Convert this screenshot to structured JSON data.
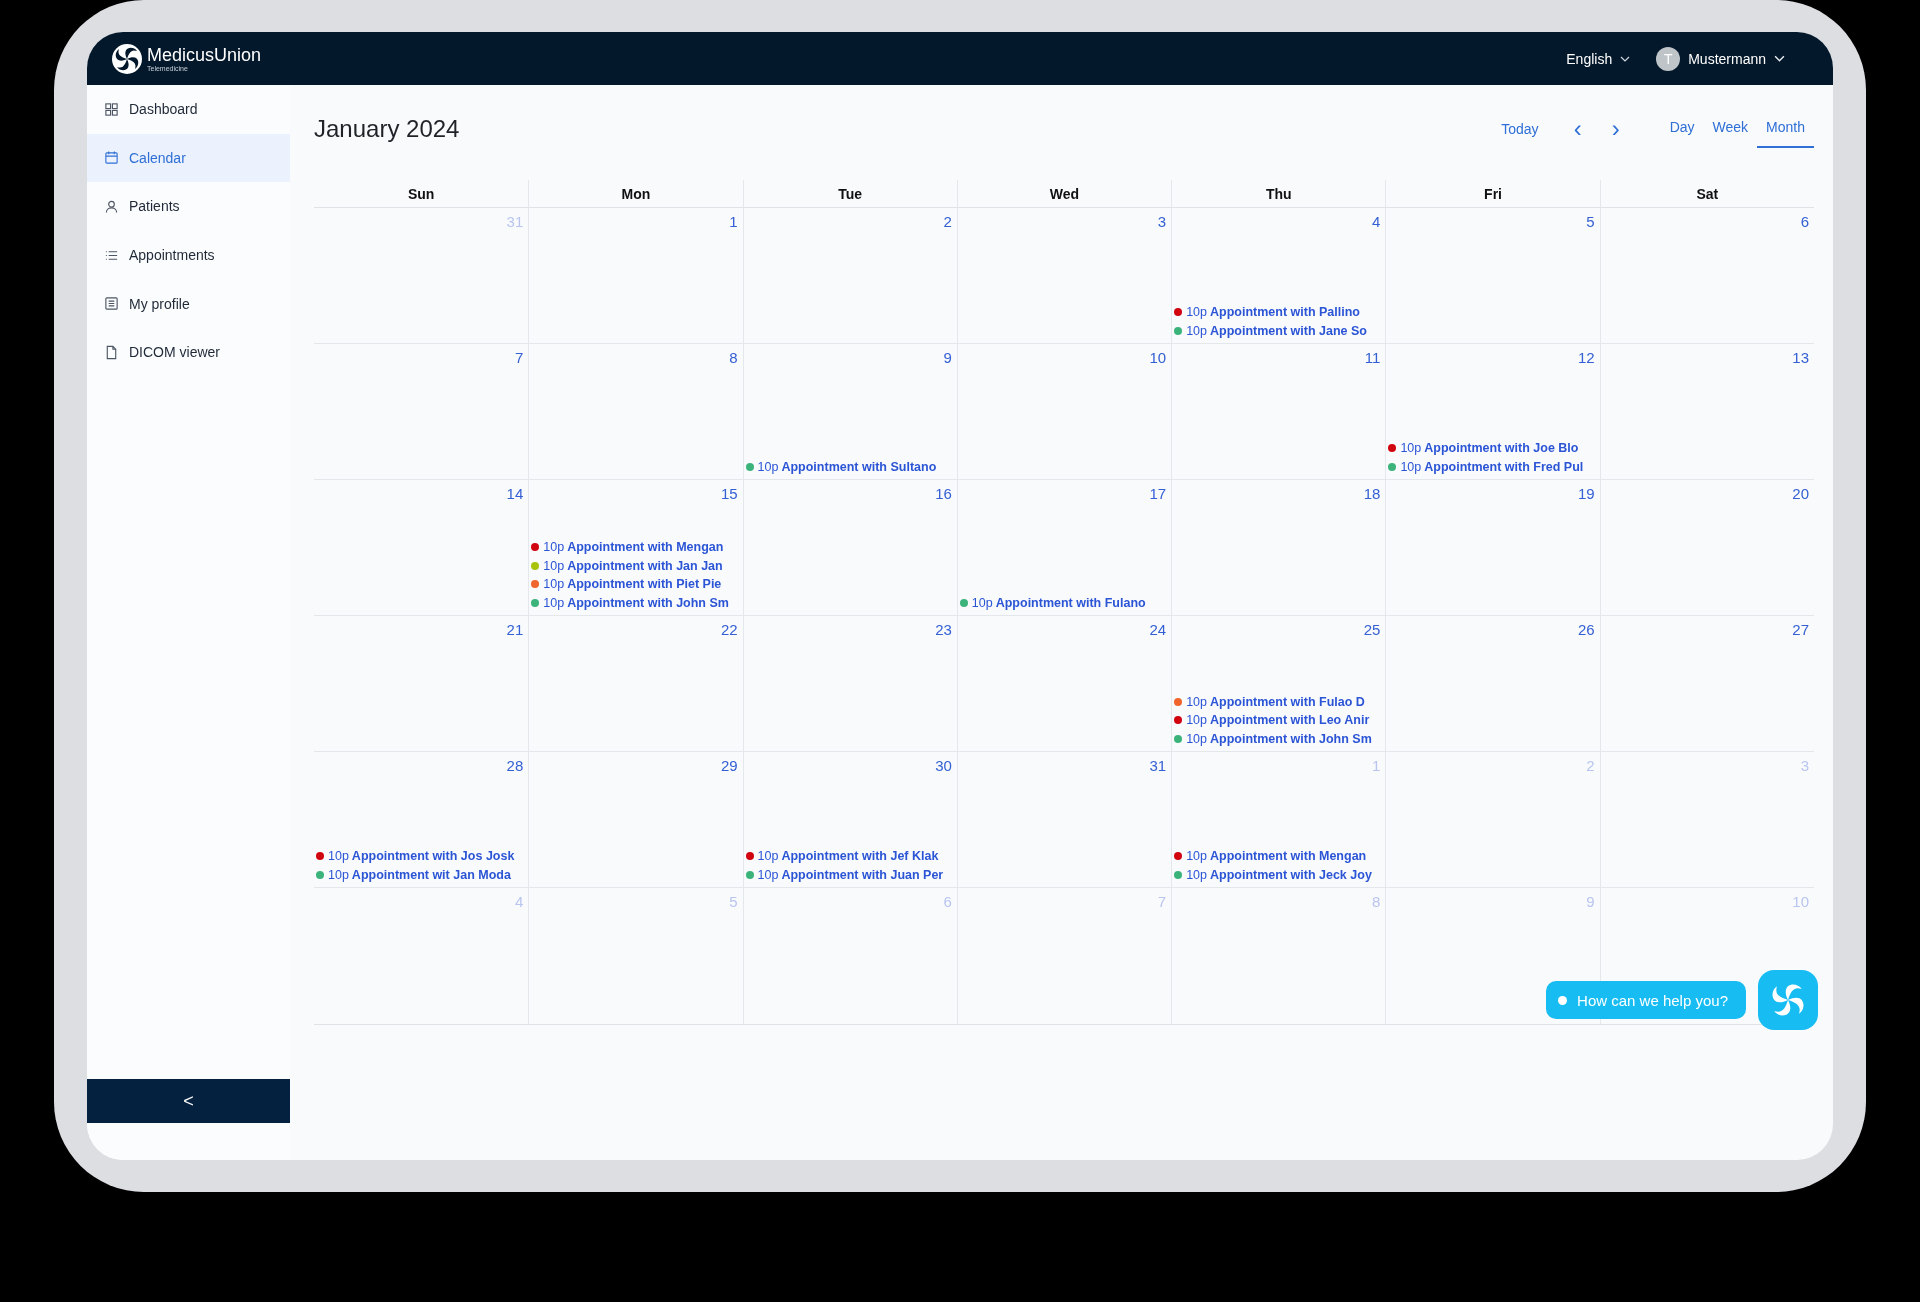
{
  "header": {
    "brand": "MedicusUnion",
    "tagline": "Telemedicine",
    "language": "English",
    "user": {
      "initial": "T",
      "name": "Mustermann"
    }
  },
  "sidebar": {
    "items": [
      {
        "label": "Dashboard",
        "selected": false
      },
      {
        "label": "Calendar",
        "selected": true
      },
      {
        "label": "Patients",
        "selected": false
      },
      {
        "label": "Appointments",
        "selected": false
      },
      {
        "label": "My profile",
        "selected": false
      },
      {
        "label": "DICOM viewer",
        "selected": false
      }
    ],
    "collapse": "<"
  },
  "calendar": {
    "title": "January 2024",
    "today": "Today",
    "prev": "‹",
    "next": "›",
    "views": [
      {
        "label": "Day",
        "selected": false
      },
      {
        "label": "Week",
        "selected": false
      },
      {
        "label": "Month",
        "selected": true
      }
    ],
    "weekdays": [
      "Sun",
      "Mon",
      "Tue",
      "Wed",
      "Thu",
      "Fri",
      "Sat"
    ],
    "weeks": [
      {
        "days": [
          {
            "date": "31",
            "outside": true
          },
          {
            "date": "1",
            "outside": false
          },
          {
            "date": "2",
            "outside": false
          },
          {
            "date": "3",
            "outside": false
          },
          {
            "date": "4",
            "outside": false,
            "events": [
              {
                "time": "10p",
                "title": "Appointment with Pallino",
                "color": "#d0050f"
              },
              {
                "time": "10p",
                "title": "Appointment with Jane So",
                "color": "#3cb37a"
              }
            ]
          },
          {
            "date": "5",
            "outside": false
          },
          {
            "date": "6",
            "outside": false
          }
        ]
      },
      {
        "days": [
          {
            "date": "7",
            "outside": false
          },
          {
            "date": "8",
            "outside": false
          },
          {
            "date": "9",
            "outside": false,
            "events": [
              {
                "time": "10p",
                "title": "Appointment with Sultano",
                "color": "#3cb37a"
              }
            ]
          },
          {
            "date": "10",
            "outside": false
          },
          {
            "date": "11",
            "outside": false
          },
          {
            "date": "12",
            "outside": false,
            "events": [
              {
                "time": "10p",
                "title": "Appointment with Joe Blo",
                "color": "#d0050f"
              },
              {
                "time": "10p",
                "title": "Appointment with Fred Pul",
                "color": "#3cb37a"
              }
            ]
          },
          {
            "date": "13",
            "outside": false
          }
        ]
      },
      {
        "days": [
          {
            "date": "14",
            "outside": false
          },
          {
            "date": "15",
            "outside": false,
            "events": [
              {
                "time": "10p",
                "title": "Appointment with Mengan",
                "color": "#d0050f"
              },
              {
                "time": "10p",
                "title": "Appointment with Jan Jan",
                "color": "#a9c20c"
              },
              {
                "time": "10p",
                "title": "Appointment with Piet Pie",
                "color": "#f0652b"
              },
              {
                "time": "10p",
                "title": "Appointment with John Sm",
                "color": "#3cb37a"
              }
            ]
          },
          {
            "date": "16",
            "outside": false
          },
          {
            "date": "17",
            "outside": false,
            "events": [
              {
                "time": "10p",
                "title": "Appointment with Fulano",
                "color": "#3cb37a"
              }
            ]
          },
          {
            "date": "18",
            "outside": false
          },
          {
            "date": "19",
            "outside": false
          },
          {
            "date": "20",
            "outside": false
          }
        ]
      },
      {
        "days": [
          {
            "date": "21",
            "outside": false
          },
          {
            "date": "22",
            "outside": false
          },
          {
            "date": "23",
            "outside": false
          },
          {
            "date": "24",
            "outside": false
          },
          {
            "date": "25",
            "outside": false,
            "events": [
              {
                "time": "10p",
                "title": "Appointment with Fulao D",
                "color": "#f0652b"
              },
              {
                "time": "10p",
                "title": "Appointment with Leo Anir",
                "color": "#d0050f"
              },
              {
                "time": "10p",
                "title": "Appointment with John Sm",
                "color": "#3cb37a"
              }
            ]
          },
          {
            "date": "26",
            "outside": false
          },
          {
            "date": "27",
            "outside": false
          }
        ]
      },
      {
        "days": [
          {
            "date": "28",
            "outside": false,
            "events": [
              {
                "time": "10p",
                "title": "Appointment with Jos Josk",
                "color": "#d0050f"
              },
              {
                "time": "10p",
                "title": "Appointment wit Jan Moda",
                "color": "#3cb37a"
              }
            ]
          },
          {
            "date": "29",
            "outside": false
          },
          {
            "date": "30",
            "outside": false,
            "events": [
              {
                "time": "10p",
                "title": "Appointment with Jef Klak",
                "color": "#d0050f"
              },
              {
                "time": "10p",
                "title": "Appointment with Juan Per",
                "color": "#3cb37a"
              }
            ]
          },
          {
            "date": "31",
            "outside": false
          },
          {
            "date": "1",
            "outside": true,
            "events": [
              {
                "time": "10p",
                "title": "Appointment with Mengan",
                "color": "#d0050f"
              },
              {
                "time": "10p",
                "title": "Appointment with Jeck Joy",
                "color": "#3cb37a"
              }
            ]
          },
          {
            "date": "2",
            "outside": true
          },
          {
            "date": "3",
            "outside": true
          }
        ]
      },
      {
        "days": [
          {
            "date": "4",
            "outside": true
          },
          {
            "date": "5",
            "outside": true
          },
          {
            "date": "6",
            "outside": true
          },
          {
            "date": "7",
            "outside": true
          },
          {
            "date": "8",
            "outside": true
          },
          {
            "date": "9",
            "outside": true
          },
          {
            "date": "10",
            "outside": true
          }
        ]
      }
    ]
  },
  "chat": {
    "prompt": "How can we help you?"
  }
}
